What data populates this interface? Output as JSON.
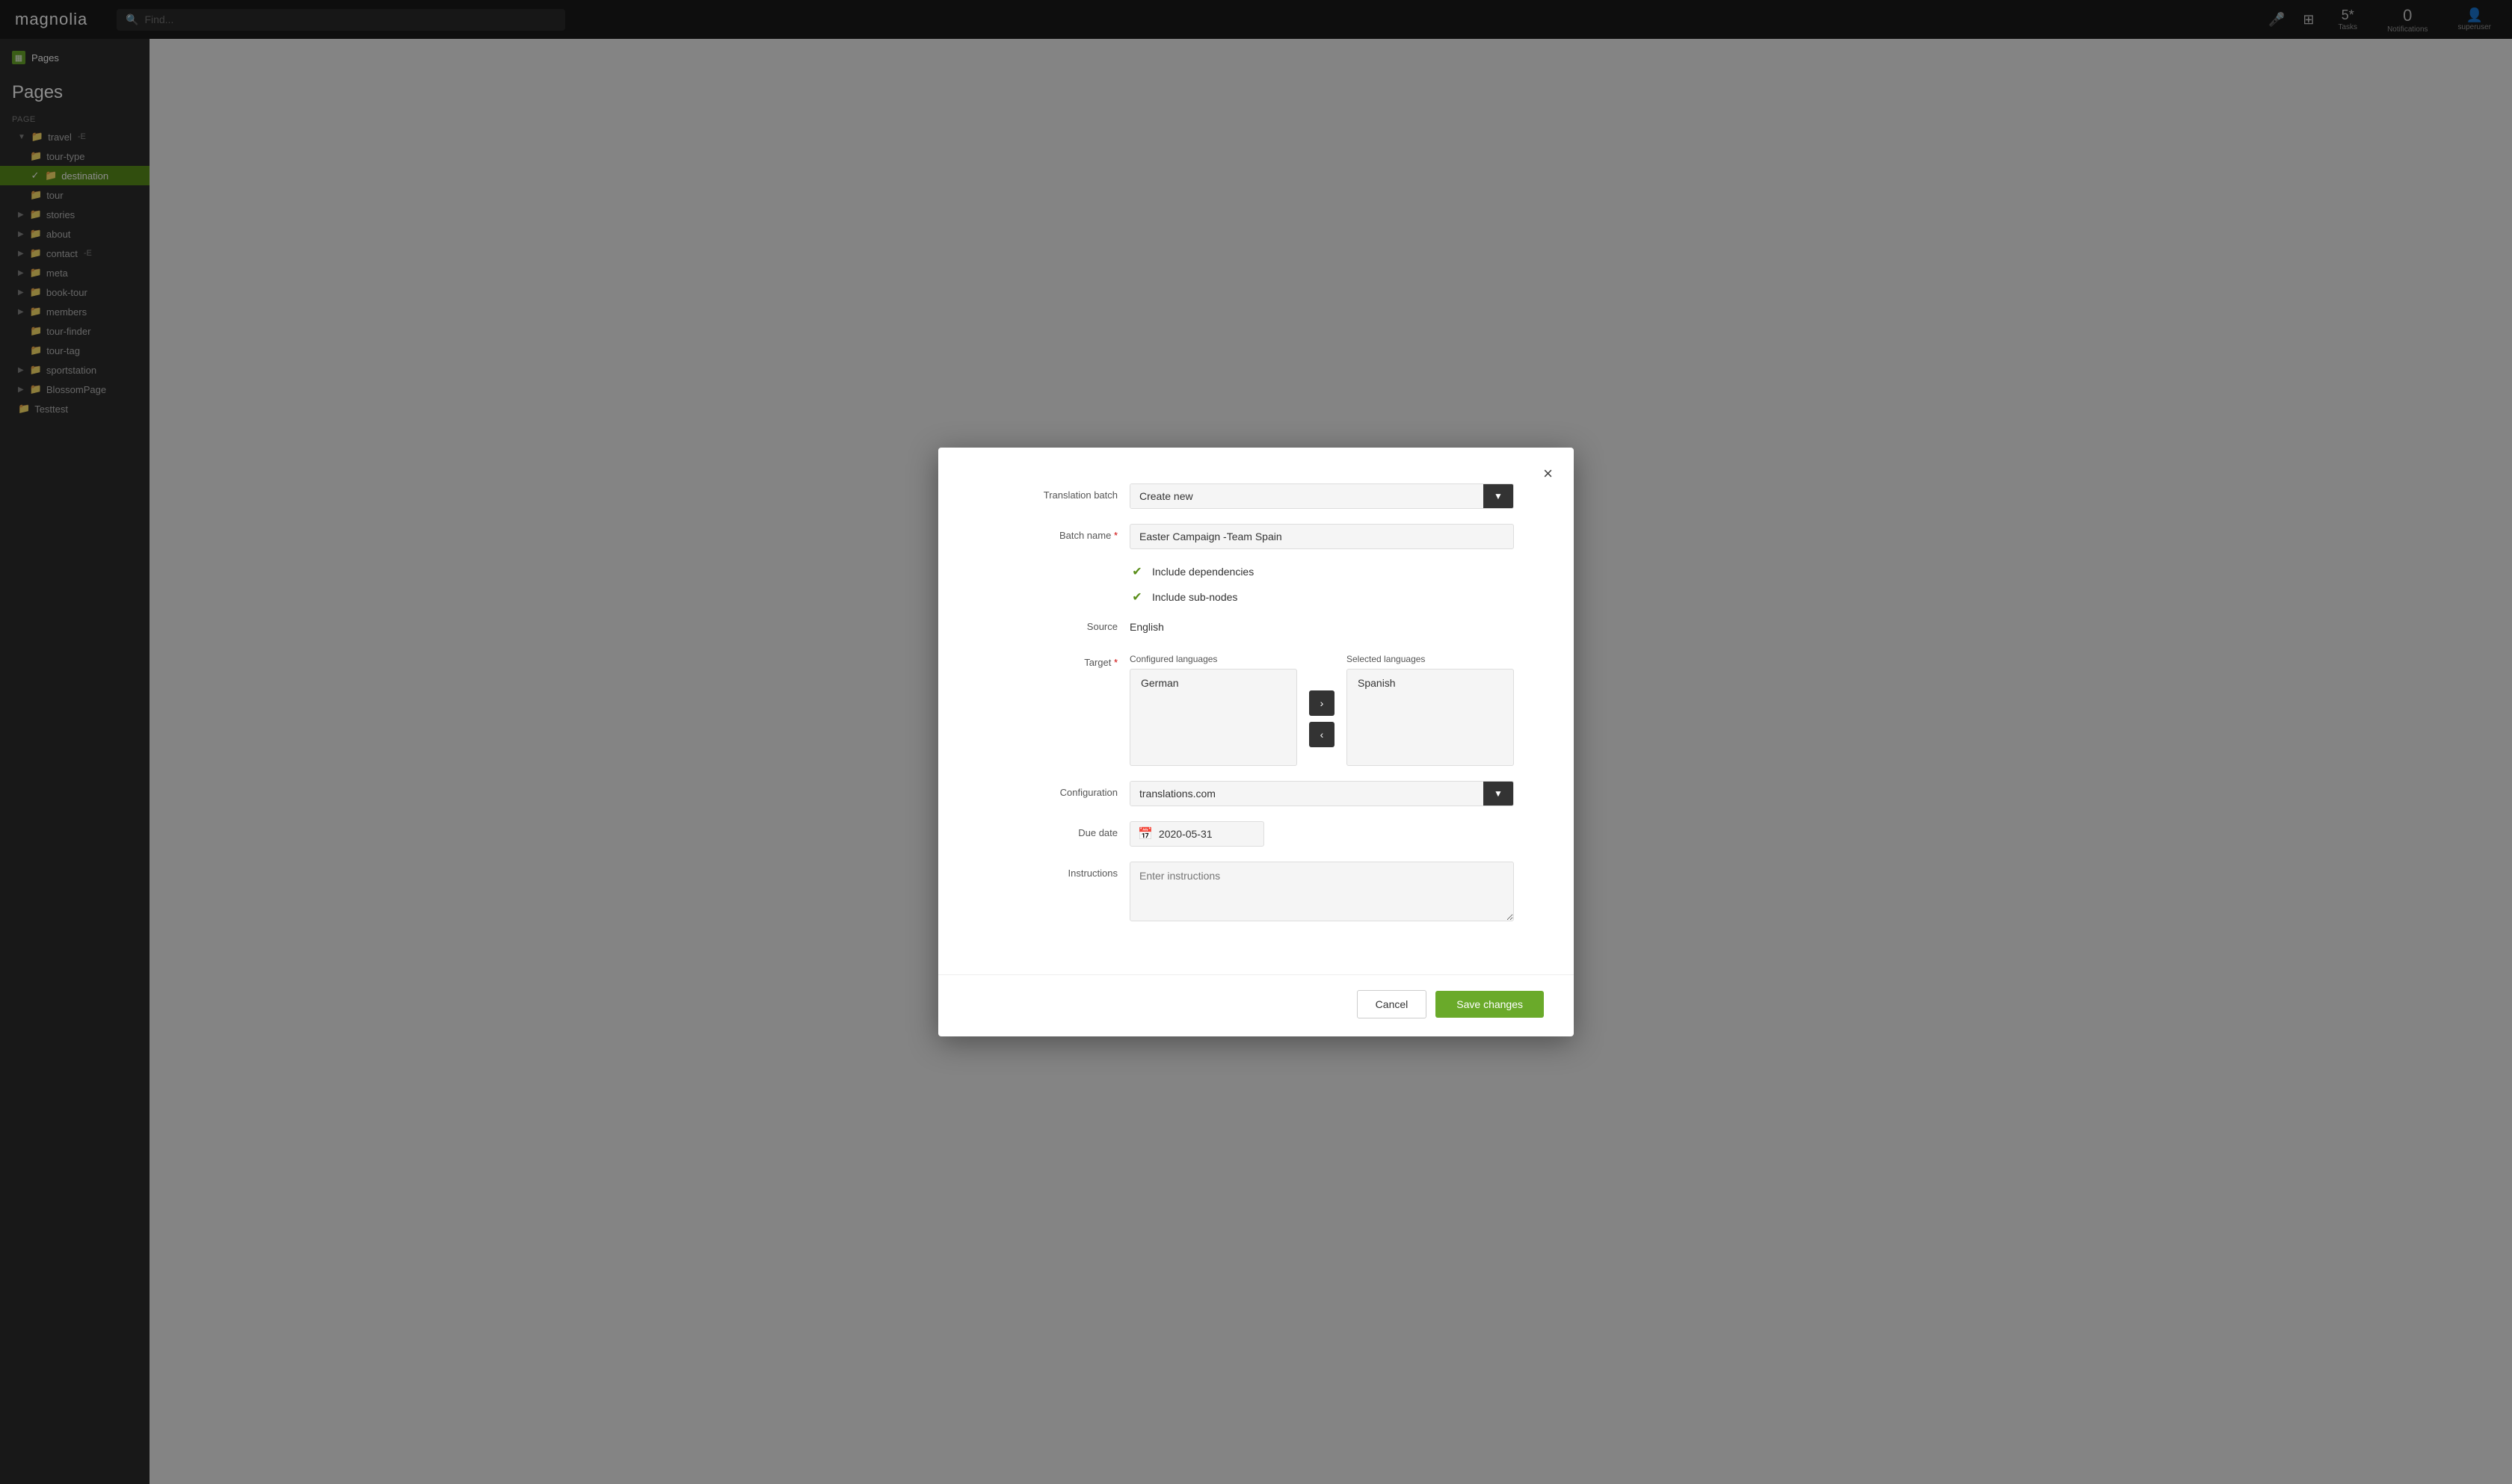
{
  "app": {
    "title": "Magnolia",
    "logo": "magnolia"
  },
  "topbar": {
    "search_placeholder": "Find...",
    "mic_icon": "🎤",
    "grid_icon": "⊞",
    "tasks_label": "Tasks",
    "tasks_count": "5*",
    "notifications_label": "Notifications",
    "notifications_count": "0",
    "user_label": "superuser",
    "user_icon": "👤"
  },
  "sidebar": {
    "app_label": "Pages",
    "section_label": "Page",
    "page_heading": "Pages",
    "tree_items": [
      {
        "id": "travel",
        "label": "travel",
        "indent": 1,
        "expanded": true,
        "type": "folder",
        "checked": false
      },
      {
        "id": "tour-type",
        "label": "tour-type",
        "indent": 2,
        "type": "folder",
        "checked": false
      },
      {
        "id": "destination",
        "label": "destination",
        "indent": 2,
        "type": "folder",
        "checked": true,
        "active": true
      },
      {
        "id": "tour",
        "label": "tour",
        "indent": 2,
        "type": "folder",
        "checked": false
      },
      {
        "id": "stories",
        "label": "stories",
        "indent": 1,
        "type": "folder",
        "checked": false
      },
      {
        "id": "about",
        "label": "about",
        "indent": 1,
        "type": "folder",
        "checked": false
      },
      {
        "id": "contact",
        "label": "contact",
        "indent": 1,
        "type": "folder",
        "checked": false
      },
      {
        "id": "meta",
        "label": "meta",
        "indent": 1,
        "type": "folder",
        "checked": false
      },
      {
        "id": "book-tour",
        "label": "book-tour",
        "indent": 1,
        "type": "folder",
        "checked": false
      },
      {
        "id": "members",
        "label": "members",
        "indent": 1,
        "type": "folder",
        "checked": false
      },
      {
        "id": "tour-finder",
        "label": "tour-finder",
        "indent": 2,
        "type": "folder",
        "checked": false
      },
      {
        "id": "tour-tag",
        "label": "tour-tag",
        "indent": 2,
        "type": "folder",
        "checked": false
      },
      {
        "id": "sportstation",
        "label": "sportstation",
        "indent": 1,
        "type": "folder",
        "checked": false
      },
      {
        "id": "BlossomPage",
        "label": "BlossomPage",
        "indent": 1,
        "type": "folder",
        "checked": false
      },
      {
        "id": "Testtest",
        "label": "Testtest",
        "indent": 1,
        "type": "folder",
        "checked": false
      }
    ]
  },
  "modal": {
    "close_label": "×",
    "translation_batch_label": "Translation batch",
    "translation_batch_value": "Create new",
    "batch_name_label": "Batch name",
    "batch_name_value": "Easter Campaign -Team Spain",
    "include_dependencies_label": "Include dependencies",
    "include_sub_nodes_label": "Include sub-nodes",
    "source_label": "Source",
    "source_value": "English",
    "target_label": "Target",
    "configured_languages_label": "Configured languages",
    "selected_languages_label": "Selected languages",
    "configured_langs": [
      "German"
    ],
    "selected_langs": [
      "Spanish"
    ],
    "arrow_right": "›",
    "arrow_left": "‹",
    "configuration_label": "Configuration",
    "configuration_value": "translations.com",
    "due_date_label": "Due date",
    "due_date_value": "2020-05-31",
    "instructions_label": "Instructions",
    "instructions_placeholder": "Enter instructions",
    "cancel_label": "Cancel",
    "save_label": "Save changes"
  }
}
